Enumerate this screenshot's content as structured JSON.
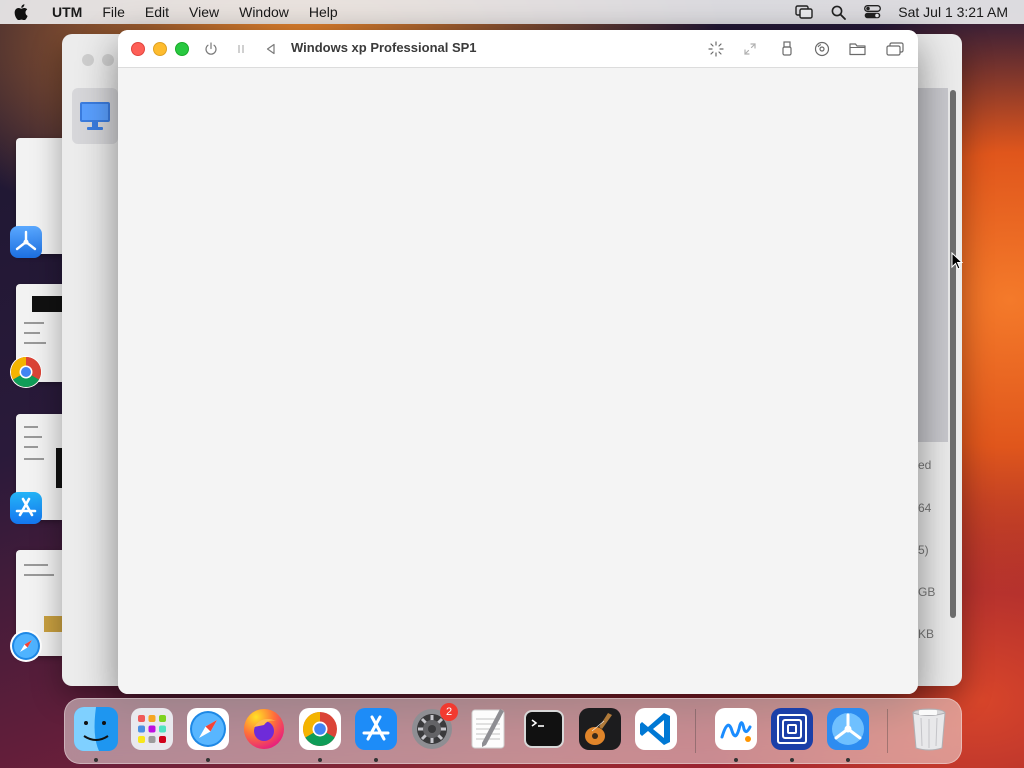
{
  "menubar": {
    "app_name": "UTM",
    "menus": [
      "File",
      "Edit",
      "View",
      "Window",
      "Help"
    ],
    "clock": "Sat Jul 1  3:21 AM",
    "status_icons": [
      "screen-mirroring-icon",
      "spotlight-search-icon",
      "control-center-icon"
    ]
  },
  "vm_window": {
    "title": "Windows xp Professional SP1",
    "toolbar_left": [
      "power-icon",
      "pause-icon",
      "back-icon"
    ],
    "toolbar_right": [
      "capture-input-icon",
      "resize-icon",
      "usb-icon",
      "drive-icon",
      "shared-folder-icon",
      "windows-icon"
    ]
  },
  "library_window": {
    "details": [
      "ed",
      "64",
      "5)",
      "GB",
      "KB"
    ]
  },
  "dock": {
    "apps": [
      {
        "name": "Finder",
        "icon": "finder-icon",
        "running": true
      },
      {
        "name": "Launchpad",
        "icon": "launchpad-icon",
        "running": false
      },
      {
        "name": "Safari",
        "icon": "safari-icon",
        "running": true
      },
      {
        "name": "Firefox",
        "icon": "firefox-icon",
        "running": false
      },
      {
        "name": "Google Chrome",
        "icon": "chrome-icon",
        "running": true
      },
      {
        "name": "App Store",
        "icon": "app-store-icon",
        "running": true
      },
      {
        "name": "System Settings",
        "icon": "system-settings-icon",
        "running": false,
        "badge": "2"
      },
      {
        "name": "TextEdit",
        "icon": "textedit-icon",
        "running": false
      },
      {
        "name": "Terminal",
        "icon": "terminal-icon",
        "running": false
      },
      {
        "name": "GarageBand",
        "icon": "garageband-icon",
        "running": false
      },
      {
        "name": "Visual Studio Code",
        "icon": "vscode-icon",
        "running": false
      },
      {
        "name": "Freeform",
        "icon": "freeform-icon",
        "running": true
      },
      {
        "name": "Unknown App",
        "icon": "spiral-app-icon",
        "running": true
      },
      {
        "name": "UTM",
        "icon": "utm-icon",
        "running": true
      },
      {
        "name": "Trash",
        "icon": "trash-icon",
        "running": false
      }
    ]
  }
}
